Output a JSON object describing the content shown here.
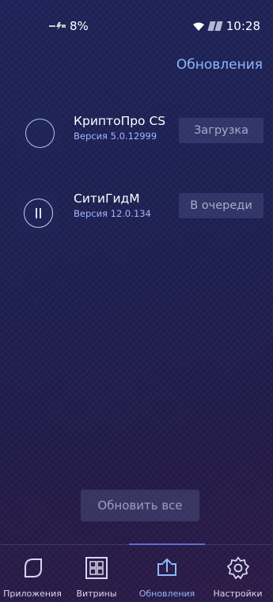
{
  "status_bar": {
    "battery": "8%",
    "time": "10:28"
  },
  "header": {
    "title": "Обновления"
  },
  "apps": [
    {
      "name": "КриптоПро CS",
      "version": "Версия 5.0.12999",
      "state": "Загрузка",
      "icon": "loading-ring-icon"
    },
    {
      "name": "СитиГидМ",
      "version": "Версия 12.0.134",
      "state": "В очереди",
      "icon": "pause-icon"
    }
  ],
  "update_all_label": "Обновить все",
  "tabs": [
    {
      "label": "Приложения",
      "icon": "leaf-icon",
      "active": false
    },
    {
      "label": "Витрины",
      "icon": "grid-icon",
      "active": false
    },
    {
      "label": "Обновления",
      "icon": "upload-icon",
      "active": true
    },
    {
      "label": "Настройки",
      "icon": "gear-icon",
      "active": false
    }
  ],
  "colors": {
    "accent": "#8fb7ff",
    "version_text": "#9fb7ff",
    "active_tab": "#8fb7ff"
  }
}
